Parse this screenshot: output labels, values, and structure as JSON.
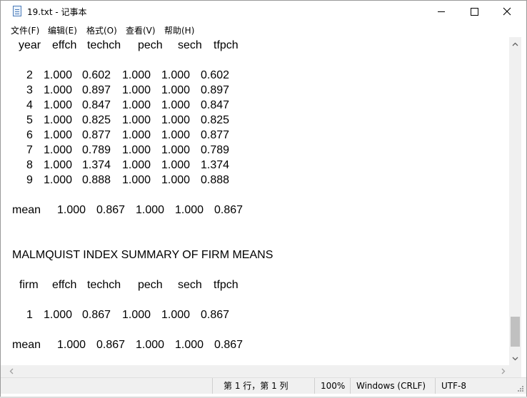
{
  "window": {
    "title": "19.txt - 记事本"
  },
  "menu": [
    {
      "label": "文件(F)"
    },
    {
      "label": "编辑(E)"
    },
    {
      "label": "格式(O)"
    },
    {
      "label": "查看(V)"
    },
    {
      "label": "帮助(H)"
    }
  ],
  "content": {
    "header1": [
      "year",
      "effch",
      "techch",
      "pech",
      "sech",
      "tfpch"
    ],
    "rows": [
      [
        "2",
        "1.000",
        "0.602",
        "1.000",
        "1.000",
        "0.602"
      ],
      [
        "3",
        "1.000",
        "0.897",
        "1.000",
        "1.000",
        "0.897"
      ],
      [
        "4",
        "1.000",
        "0.847",
        "1.000",
        "1.000",
        "0.847"
      ],
      [
        "5",
        "1.000",
        "0.825",
        "1.000",
        "1.000",
        "0.825"
      ],
      [
        "6",
        "1.000",
        "0.877",
        "1.000",
        "1.000",
        "0.877"
      ],
      [
        "7",
        "1.000",
        "0.789",
        "1.000",
        "1.000",
        "0.789"
      ],
      [
        "8",
        "1.000",
        "1.374",
        "1.000",
        "1.000",
        "1.374"
      ],
      [
        "9",
        "1.000",
        "0.888",
        "1.000",
        "1.000",
        "0.888"
      ]
    ],
    "mean1": [
      "mean",
      "1.000",
      "0.867",
      "1.000",
      "1.000",
      "0.867"
    ],
    "summary_title": "MALMQUIST INDEX SUMMARY OF FIRM MEANS",
    "header2": [
      "firm",
      "effch",
      "techch",
      "pech",
      "sech",
      "tfpch"
    ],
    "firm_rows": [
      [
        "1",
        "1.000",
        "0.867",
        "1.000",
        "1.000",
        "0.867"
      ]
    ],
    "mean2": [
      "mean",
      "1.000",
      "0.867",
      "1.000",
      "1.000",
      "0.867"
    ]
  },
  "status": {
    "position": "第 1 行，第 1 列",
    "zoom": "100%",
    "line_ending": "Windows (CRLF)",
    "encoding": "UTF-8"
  }
}
